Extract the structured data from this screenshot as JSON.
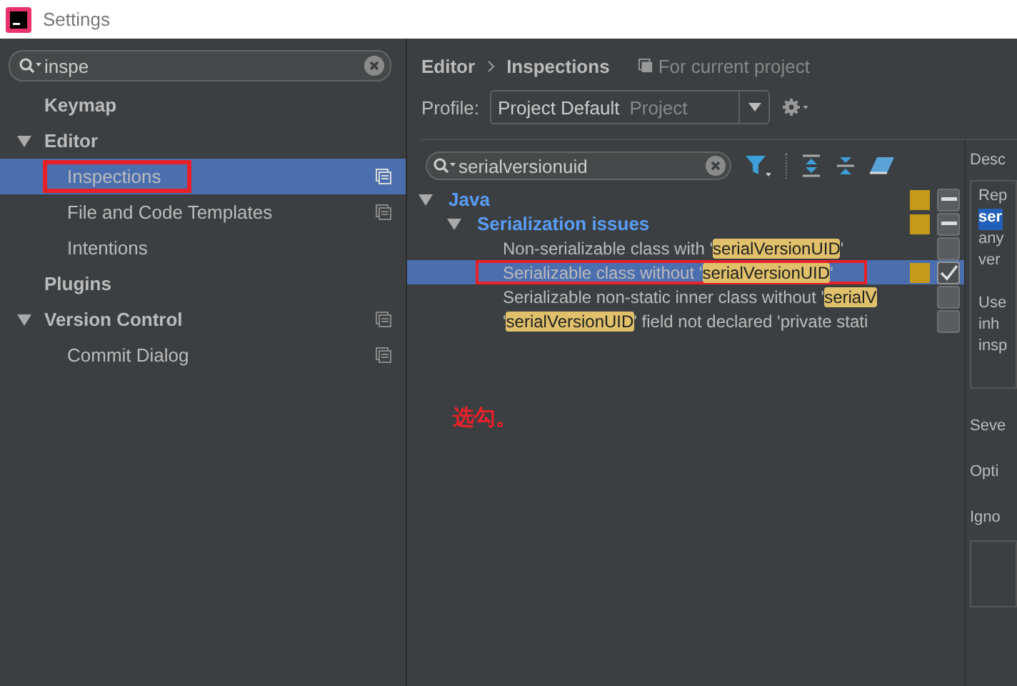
{
  "window": {
    "title": "Settings"
  },
  "sidebar": {
    "search": {
      "value": "inspe"
    },
    "items": [
      {
        "label": "Keymap",
        "selected": false,
        "project_icon": false
      },
      {
        "label": "Editor",
        "selected": false,
        "project_icon": false,
        "expanded": true,
        "children": [
          {
            "label": "Inspections",
            "selected": true,
            "project_icon": true
          },
          {
            "label": "File and Code Templates",
            "selected": false,
            "project_icon": true
          },
          {
            "label": "Intentions",
            "selected": false,
            "project_icon": false
          }
        ]
      },
      {
        "label": "Plugins",
        "selected": false,
        "project_icon": false
      },
      {
        "label": "Version Control",
        "selected": false,
        "project_icon": true,
        "expanded": true,
        "children": [
          {
            "label": "Commit Dialog",
            "selected": false,
            "project_icon": true
          }
        ]
      }
    ]
  },
  "breadcrumb": [
    "Editor",
    "Inspections"
  ],
  "scope_note": "For current project",
  "profile": {
    "label": "Profile:",
    "value": "Project Default",
    "scope": "Project"
  },
  "filter": {
    "value": "serialversionuid"
  },
  "tree": [
    {
      "label": "Java",
      "severity_mark": true,
      "partial": true,
      "expanded": true,
      "selected": false,
      "children": [
        {
          "label": "Serialization issues",
          "severity_mark": true,
          "partial": true,
          "expanded": true,
          "selected": false,
          "children": [
            {
              "parts": [
                {
                  "text": "Non-serializable class with '",
                  "match": false
                },
                {
                  "text": "serialVersionUID",
                  "match": true
                },
                {
                  "text": "'",
                  "match": false
                }
              ],
              "severity_mark": false,
              "checked": false,
              "selected": false
            },
            {
              "parts": [
                {
                  "text": "Serializable class without '",
                  "match": false
                },
                {
                  "text": "serialVersionUID",
                  "match": true
                },
                {
                  "text": "'",
                  "match": false
                }
              ],
              "severity_mark": true,
              "checked": true,
              "selected": true
            },
            {
              "parts": [
                {
                  "text": "Serializable non-static inner class without '",
                  "match": false
                },
                {
                  "text": "serialV",
                  "match": true
                }
              ],
              "severity_mark": false,
              "checked": false,
              "selected": false
            },
            {
              "parts": [
                {
                  "text": "'",
                  "match": false
                },
                {
                  "text": "serialVersionUID",
                  "match": true
                },
                {
                  "text": "' field not declared 'private stati",
                  "match": false
                }
              ],
              "severity_mark": false,
              "checked": false,
              "selected": false
            }
          ]
        }
      ]
    }
  ],
  "annotation": "选勾。",
  "description": {
    "label": "Desc",
    "paragraphs": [
      [
        {
          "text": "Rep",
          "match": false
        },
        {
          "text": "ser",
          "match": true
        },
        {
          "text": "any",
          "match": false
        },
        {
          "text": "ver",
          "match": false
        }
      ],
      [
        {
          "text": "Use",
          "match": false
        },
        {
          "text": "inh",
          "match": false
        },
        {
          "text": "insp",
          "match": false
        }
      ]
    ],
    "fields": [
      "Seve",
      "Opti",
      "Igno"
    ]
  }
}
